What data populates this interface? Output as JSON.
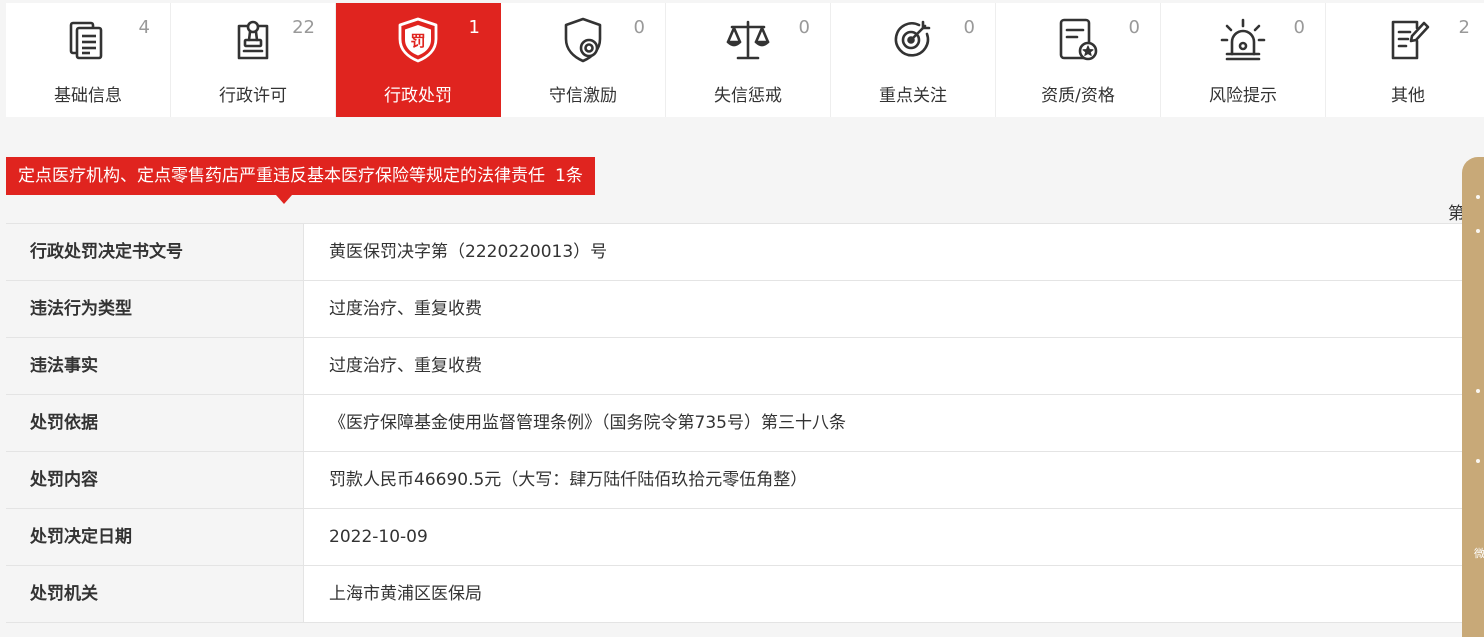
{
  "tabs": [
    {
      "label": "基础信息",
      "count": "4",
      "icon": "document-icon",
      "active": false
    },
    {
      "label": "行政许可",
      "count": "22",
      "icon": "stamp-icon",
      "active": false
    },
    {
      "label": "行政处罚",
      "count": "1",
      "icon": "penalty-shield-icon",
      "active": true
    },
    {
      "label": "守信激励",
      "count": "0",
      "icon": "credit-shield-icon",
      "active": false
    },
    {
      "label": "失信惩戒",
      "count": "0",
      "icon": "scale-icon",
      "active": false
    },
    {
      "label": "重点关注",
      "count": "0",
      "icon": "target-icon",
      "active": false
    },
    {
      "label": "资质/资格",
      "count": "0",
      "icon": "certificate-icon",
      "active": false
    },
    {
      "label": "风险提示",
      "count": "0",
      "icon": "alarm-icon",
      "active": false
    },
    {
      "label": "其他",
      "count": "2",
      "icon": "checklist-icon",
      "active": false
    }
  ],
  "penalty_icon_text": "罚",
  "banner": {
    "title": "定点医疗机构、定点零售药店严重违反基本医疗保险等规定的法律责任",
    "count": "1条"
  },
  "page_marker": "第",
  "detail": [
    {
      "key": "行政处罚决定书文号",
      "value": "黄医保罚决字第（2220220013）号"
    },
    {
      "key": "违法行为类型",
      "value": "过度治疗、重复收费"
    },
    {
      "key": "违法事实",
      "value": "过度治疗、重复收费"
    },
    {
      "key": "处罚依据",
      "value": "《医疗保障基金使用监督管理条例》（国务院令第735号）第三十八条"
    },
    {
      "key": "处罚内容",
      "value": "罚款人民币46690.5元（大写：肆万陆仟陆佰玖拾元零伍角整）"
    },
    {
      "key": "处罚决定日期",
      "value": "2022-10-09"
    },
    {
      "key": "处罚机关",
      "value": "上海市黄浦区医保局"
    }
  ],
  "side_panel_char": "微",
  "colors": {
    "accent": "#e0241f",
    "side_panel": "#c8a978"
  }
}
